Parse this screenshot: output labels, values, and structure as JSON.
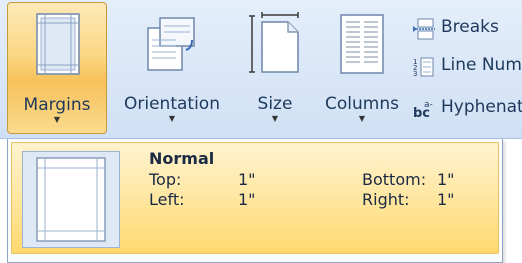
{
  "ribbon": {
    "margins_label": "Margins",
    "orientation_label": "Orientation",
    "size_label": "Size",
    "columns_label": "Columns",
    "breaks_label": "Breaks",
    "line_numbers_label": "Line Numbers",
    "hyphenation_label": "Hyphenation",
    "dropdown_arrow": "▼"
  },
  "icons": {
    "margins": "margins-icon",
    "orientation": "orientation-icon",
    "size": "size-icon",
    "columns": "columns-icon",
    "breaks": "breaks-icon",
    "line_numbers": "line-numbers-icon",
    "hyphenation": "hyphenation-icon"
  },
  "colors": {
    "accent_highlight": "#f7c15a",
    "ribbon_bg": "#dbe8f8",
    "label_text": "#1e395b"
  },
  "margins_menu": {
    "selected_preset": {
      "name": "Normal",
      "top_label": "Top:",
      "top_value": "1\"",
      "bottom_label": "Bottom:",
      "bottom_value": "1\"",
      "left_label": "Left:",
      "left_value": "1\"",
      "right_label": "Right:",
      "right_value": "1\""
    }
  }
}
